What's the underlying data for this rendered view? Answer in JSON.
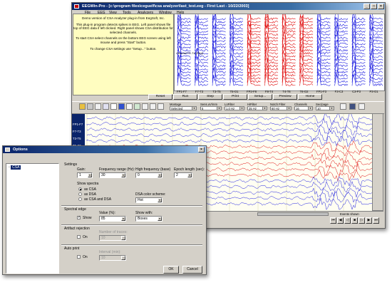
{
  "main_window": {
    "title": "EEGWin-Pro - [c:\\program files\\ceguelf\\csa analyzer\\last_test.eeg - First Last - 10/22/2003]",
    "menu": [
      "File",
      "EEG",
      "View",
      "Tools",
      "Analyzers",
      "Window",
      "Help"
    ],
    "info_text": [
      "Demo version of CSA Analyzer plug-in from EegSoft, Inc.",
      "This plug-in program detects spikes in EEG. Left panel shows file top of EEG data if left clicked. Right panel shows CSA distribution for selected channels.",
      "To start CSA select channels on the bottom EEG screen using left mouse and press \"Start\" button.",
      "To change CSA settings use \"Setup...\" button."
    ],
    "csa_label": "Channel F1-T4 (Red)",
    "csa_channels": [
      "FP1-F7",
      "F7-T3",
      "T3-T5",
      "T5-O1",
      "FP2-F8",
      "F8-T4",
      "T4-T6",
      "T6-O2",
      "FP1-F3",
      "F3-C3",
      "C3-P3",
      "P3-O1"
    ],
    "buttons": [
      "Reset",
      "Run",
      "Step",
      "Print",
      "Setup...",
      "Preview",
      "Home"
    ],
    "toolbar": {
      "montage": {
        "label": "Montage",
        "value": "Selected"
      },
      "sens": {
        "label": "Sens.uV/mm",
        "value": "5"
      },
      "lofilter": {
        "label": "LoFilter",
        "value": "1.0 Hz"
      },
      "hifilter": {
        "label": "HiFilter",
        "value": "35 Hz"
      },
      "notch": {
        "label": "Notch Filter",
        "value": "60 Hz"
      },
      "channels": {
        "label": "Channels",
        "value": "16"
      },
      "secpage": {
        "label": "Sec/page",
        "value": "10"
      }
    },
    "eeg_channel_names": [
      "FP1-F7",
      "F7-T3",
      "T3-T5",
      "T5-O1"
    ],
    "events_label": "Events shown"
  },
  "options_dialog": {
    "title": "Options",
    "tree_item": "CSA",
    "settings_label": "Settings",
    "gain": {
      "label": "Gain:",
      "value": "1"
    },
    "freq_range": {
      "label": "Frequency range (Hz):",
      "value": "30"
    },
    "high_freq": {
      "label": "High frequency (base)",
      "value": "0"
    },
    "epoch_length": {
      "label": "Epoch length (sec):",
      "value": "2"
    },
    "show_spectra": {
      "label": "Show spectra",
      "options": [
        "as CSA",
        "as DSA",
        "as CSA and DSA"
      ],
      "selected": 0
    },
    "dsa_scheme": {
      "label": "DSA color scheme:",
      "value": "Hot"
    },
    "spectral_edge": {
      "label": "Spectral edge",
      "show_label": "Show",
      "checked": true,
      "value_label": "Value (%):",
      "value": "85",
      "show_with_label": "Show with:",
      "show_with": "Boxes"
    },
    "artifact": {
      "label": "Artifact rejection",
      "on_label": "On",
      "checked": false,
      "traces_label": "Number of traces:",
      "traces_value": "10"
    },
    "auto_print": {
      "label": "Auto print",
      "on_label": "On",
      "checked": false,
      "interval_label": "Interval (min):",
      "interval_value": "10"
    },
    "ok_label": "OK",
    "cancel_label": "Cancel"
  },
  "colors": {
    "blue_trace": "#2020e0",
    "red_trace": "#e01010",
    "title_active": "#0a246a"
  }
}
